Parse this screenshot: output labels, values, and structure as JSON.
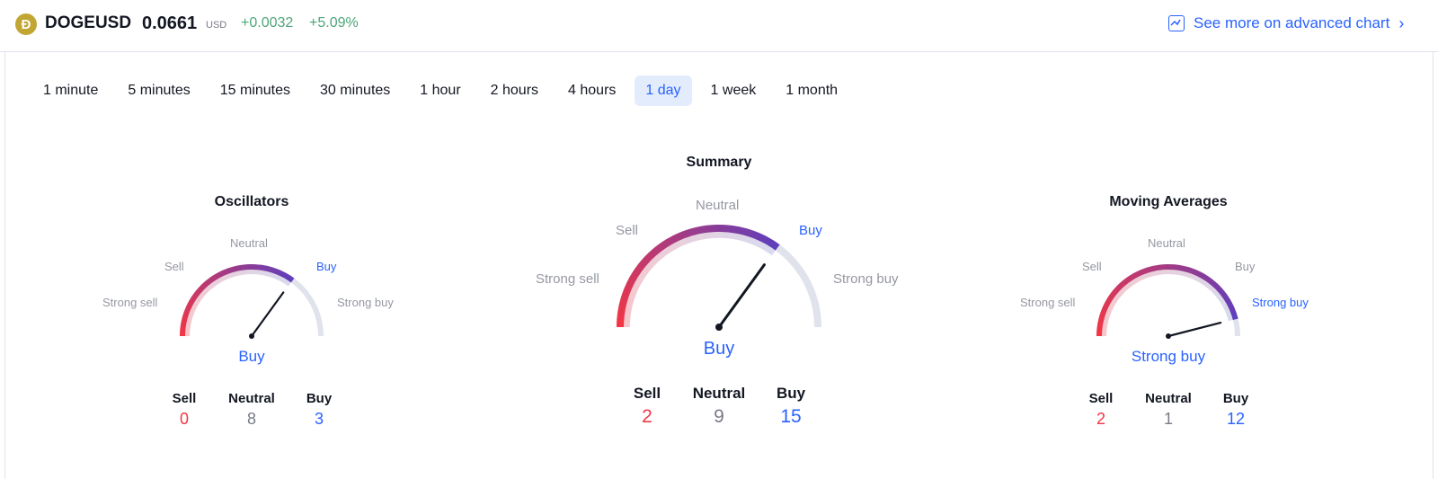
{
  "header": {
    "logo_letter": "Ð",
    "symbol": "DOGEUSD",
    "price": "0.0661",
    "currency": "USD",
    "change": "+0.0032",
    "change_pct": "+5.09%",
    "advanced_link": "See more on advanced chart"
  },
  "tabs": [
    "1 minute",
    "5 minutes",
    "15 minutes",
    "30 minutes",
    "1 hour",
    "2 hours",
    "4 hours",
    "1 day",
    "1 week",
    "1 month"
  ],
  "active_tab": "1 day",
  "colors": {
    "sell": "#f23645",
    "buy": "#2962ff",
    "neutral": "#787b86",
    "track": "#e0e3eb"
  },
  "gauges": {
    "oscillators": {
      "title": "Oscillators",
      "labels": {
        "strong_sell": "Strong sell",
        "sell": "Sell",
        "neutral": "Neutral",
        "buy": "Buy",
        "strong_buy": "Strong buy"
      },
      "verdict": "Buy",
      "needle_level": 0.7,
      "counts": {
        "sell_label": "Sell",
        "neutral_label": "Neutral",
        "buy_label": "Buy",
        "sell": "0",
        "neutral": "8",
        "buy": "3"
      }
    },
    "summary": {
      "title": "Summary",
      "labels": {
        "strong_sell": "Strong sell",
        "sell": "Sell",
        "neutral": "Neutral",
        "buy": "Buy",
        "strong_buy": "Strong buy"
      },
      "verdict": "Buy",
      "needle_level": 0.7,
      "counts": {
        "sell_label": "Sell",
        "neutral_label": "Neutral",
        "buy_label": "Buy",
        "sell": "2",
        "neutral": "9",
        "buy": "15"
      }
    },
    "moving_averages": {
      "title": "Moving Averages",
      "labels": {
        "strong_sell": "Strong sell",
        "sell": "Sell",
        "neutral": "Neutral",
        "buy": "Buy",
        "strong_buy": "Strong buy"
      },
      "verdict": "Strong buy",
      "needle_level": 0.92,
      "counts": {
        "sell_label": "Sell",
        "neutral_label": "Neutral",
        "buy_label": "Buy",
        "sell": "2",
        "neutral": "1",
        "buy": "12"
      }
    }
  }
}
